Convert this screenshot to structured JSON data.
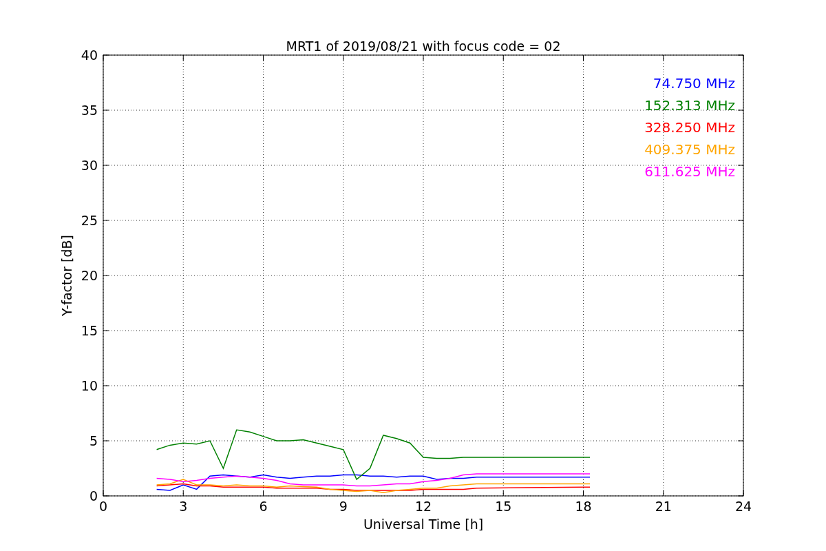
{
  "chart_data": {
    "type": "line",
    "title": "MRT1 of 2019/08/21 with focus code = 02",
    "xlabel": "Universal Time [h]",
    "ylabel": "Y-factor [dB]",
    "x": [
      2,
      2.5,
      3,
      3.5,
      4,
      4.5,
      5,
      5.5,
      6,
      6.5,
      7,
      7.5,
      8,
      8.5,
      9,
      9.5,
      10,
      10.5,
      11,
      11.5,
      12,
      12.5,
      13,
      13.5,
      14,
      18,
      18.25
    ],
    "series": [
      {
        "name": "74.750 MHz",
        "color": "#0000ff",
        "values": [
          0.6,
          0.5,
          1.0,
          0.6,
          1.8,
          1.9,
          1.8,
          1.7,
          1.9,
          1.7,
          1.6,
          1.7,
          1.8,
          1.8,
          1.9,
          1.9,
          1.8,
          1.8,
          1.7,
          1.8,
          1.8,
          1.5,
          1.6,
          1.6,
          1.7,
          1.7,
          1.7
        ]
      },
      {
        "name": "152.313 MHz",
        "color": "#008000",
        "values": [
          4.2,
          4.6,
          4.8,
          4.7,
          5.0,
          2.5,
          6.0,
          5.8,
          5.4,
          5.0,
          5.0,
          5.1,
          4.8,
          4.5,
          4.2,
          1.5,
          2.5,
          5.5,
          5.2,
          4.8,
          3.5,
          3.4,
          3.4,
          3.5,
          3.5,
          3.5,
          3.5
        ]
      },
      {
        "name": "328.250 MHz",
        "color": "#ff0000",
        "values": [
          0.9,
          1.0,
          1.1,
          0.9,
          0.9,
          0.8,
          0.8,
          0.8,
          0.8,
          0.7,
          0.7,
          0.7,
          0.7,
          0.6,
          0.6,
          0.5,
          0.5,
          0.5,
          0.5,
          0.5,
          0.6,
          0.6,
          0.6,
          0.6,
          0.7,
          0.8,
          0.8
        ]
      },
      {
        "name": "409.375 MHz",
        "color": "#ffa500",
        "values": [
          1.0,
          1.1,
          1.5,
          1.0,
          1.0,
          0.9,
          1.0,
          0.9,
          0.9,
          0.8,
          0.9,
          0.85,
          0.8,
          0.6,
          0.5,
          0.4,
          0.5,
          0.3,
          0.5,
          0.6,
          0.7,
          0.7,
          0.9,
          1.0,
          1.1,
          1.1,
          1.1
        ]
      },
      {
        "name": "611.625 MHz",
        "color": "#ff00ff",
        "values": [
          1.6,
          1.5,
          1.3,
          1.4,
          1.6,
          1.7,
          1.8,
          1.7,
          1.6,
          1.4,
          1.1,
          1.0,
          1.0,
          1.0,
          1.0,
          0.9,
          0.9,
          1.0,
          1.1,
          1.1,
          1.3,
          1.4,
          1.6,
          1.9,
          2.0,
          2.0,
          2.0
        ]
      }
    ],
    "grid": true,
    "xlim": [
      0,
      24
    ],
    "ylim": [
      0,
      40
    ],
    "xticks": [
      0,
      3,
      6,
      9,
      12,
      15,
      18,
      21,
      24
    ],
    "yticks": [
      0,
      5,
      10,
      15,
      20,
      25,
      30,
      35,
      40
    ]
  }
}
